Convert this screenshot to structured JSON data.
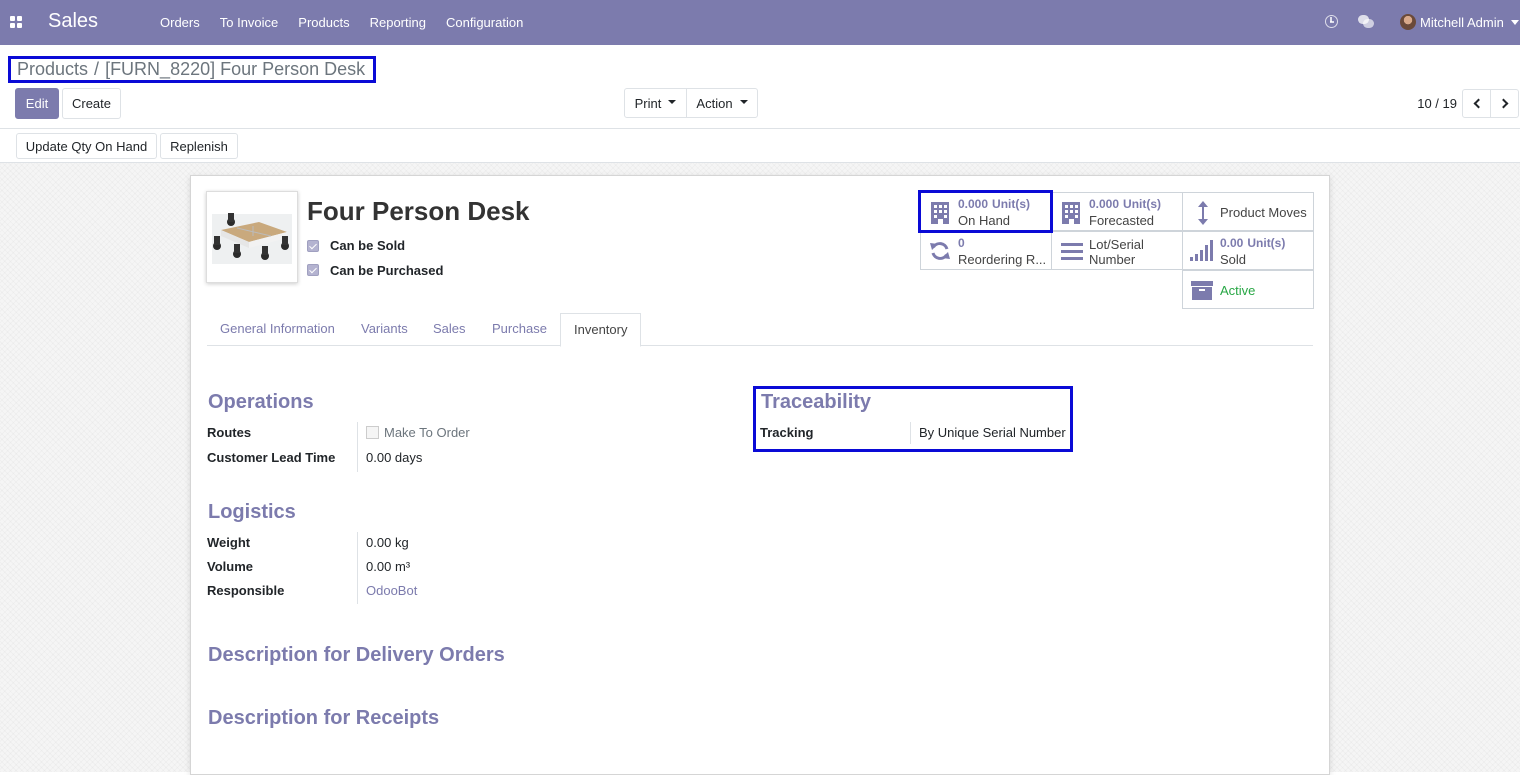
{
  "navbar": {
    "app_name": "Sales",
    "menu": [
      "Orders",
      "To Invoice",
      "Products",
      "Reporting",
      "Configuration"
    ],
    "user_name": "Mitchell Admin"
  },
  "breadcrumb": {
    "parent": "Products",
    "separator": "/",
    "current": "[FURN_8220] Four Person Desk"
  },
  "toolbar": {
    "edit_label": "Edit",
    "create_label": "Create",
    "print_label": "Print",
    "action_label": "Action",
    "pager": "10 / 19"
  },
  "header_buttons": {
    "update_qty": "Update Qty On Hand",
    "replenish": "Replenish"
  },
  "product": {
    "name": "Four Person Desk",
    "can_be_sold_label": "Can be Sold",
    "can_be_purchased_label": "Can be Purchased",
    "can_be_sold": true,
    "can_be_purchased": true
  },
  "smart_buttons": {
    "on_hand": {
      "value": "0.000",
      "unit": "Unit(s)",
      "label": "On Hand",
      "icon": "building-icon"
    },
    "forecasted": {
      "value": "0.000",
      "unit": "Unit(s)",
      "label": "Forecasted",
      "icon": "building-icon"
    },
    "product_moves": {
      "label": "Product Moves",
      "icon": "arrows-vertical-icon"
    },
    "reordering": {
      "value": "0",
      "label": "Reordering R...",
      "icon": "refresh-icon"
    },
    "lot_serial": {
      "label_line1": "Lot/Serial",
      "label_line2": "Number",
      "icon": "list-icon"
    },
    "sold": {
      "value": "0.00",
      "unit": "Unit(s)",
      "label": "Sold",
      "icon": "signal-icon"
    },
    "active": {
      "label": "Active",
      "icon": "archive-icon",
      "color": "#28a745"
    }
  },
  "tabs": [
    "General Information",
    "Variants",
    "Sales",
    "Purchase",
    "Inventory"
  ],
  "active_tab": "Inventory",
  "inventory": {
    "operations": {
      "title": "Operations",
      "routes_label": "Routes",
      "routes_option": "Make To Order",
      "lead_time_label": "Customer Lead Time",
      "lead_time_value": "0.00 days"
    },
    "traceability": {
      "title": "Traceability",
      "tracking_label": "Tracking",
      "tracking_value": "By Unique Serial Number"
    },
    "logistics": {
      "title": "Logistics",
      "weight_label": "Weight",
      "weight_value": "0.00",
      "weight_unit": "kg",
      "volume_label": "Volume",
      "volume_value": "0.00",
      "volume_unit": "m³",
      "responsible_label": "Responsible",
      "responsible_value": "OdooBot"
    },
    "description_delivery": "Description for Delivery Orders",
    "description_receipts": "Description for Receipts"
  },
  "colors": {
    "brand": "#7c7bad",
    "highlight": "#0a0ad6",
    "active_green": "#28a745"
  }
}
